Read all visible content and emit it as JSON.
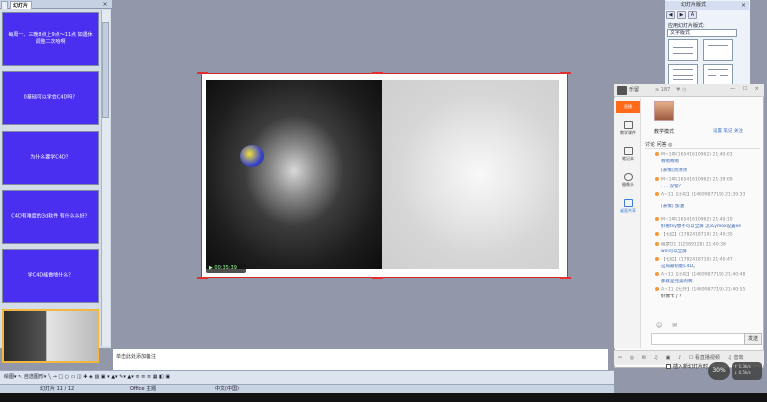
{
  "left_panel": {
    "tab_outline": "",
    "tab_slides": "幻灯片",
    "close": "×",
    "slides": [
      {
        "text": "每周一、三晚8点上9点～11点 如遇休调整二次哈啊"
      },
      {
        "text": "0基础可以学会C4D吗？"
      },
      {
        "text": "为什么要学C4D？"
      },
      {
        "text": "C4D有难度的3d软件 有什么么好？"
      },
      {
        "text": "学C4D能做啥什么？"
      },
      {
        "text": "",
        "selected": true
      }
    ]
  },
  "task_pane": {
    "title": "幻灯片版式",
    "close": "×",
    "tools": [
      "◀",
      "▶",
      "A"
    ],
    "subtitle": "应用幻灯片版式:",
    "selected_category": "文字版式"
  },
  "slide": {
    "player_time": "▶ 00:35:39"
  },
  "notes": {
    "placeholder": "单击此处添加备注"
  },
  "live": {
    "host_name": "乐留",
    "viewer_count": "≥ 187",
    "heart": "♥ ◷",
    "window_buttons": "— ☐ ×",
    "side_buttons": [
      {
        "label": "直播",
        "active": true
      },
      {
        "label": "教学课件"
      },
      {
        "label": "笔记本"
      },
      {
        "label": "摄像头"
      },
      {
        "label": "桌面共享"
      }
    ],
    "teacher_name": "教学模式",
    "teacher_links": "设置  笔记  关注",
    "tabs": "讨论    问答    ◎",
    "messages": [
      {
        "name": "M~1年(16541610962) 21:40:03",
        "text": "啦啦啦啦"
      },
      {
        "name": "",
        "text": "[表情]顶顶顶"
      },
      {
        "name": "M~1年(16541610962) 21:39:09",
        "text": ". . . 没错？"
      },
      {
        "name": "A~11【小坨】(1469987719) 21:39:33",
        "text": ""
      },
      {
        "name": "",
        "text": "[表情] 加油"
      },
      {
        "name": "M~1年(16541610962) 21:40:10",
        "text": "好看tsy想不可以全屏 怎么ymox设置ee"
      },
      {
        "name": "【七红】(1782418710) 21:40:35",
        "text": ""
      },
      {
        "name": "晓梦D1 1(2589128) 21:40:38",
        "text": "win可以全屏"
      },
      {
        "name": "【七红】(1782418710) 21:40:47",
        "text": "这局最初能C4D。"
      },
      {
        "name": "A~11【小坨】(1469987719) 21:40:48",
        "text": "那就是完美的啊"
      },
      {
        "name": "A~11【七仟】(1469987719) 21:40:55",
        "text": "好像卡了？"
      }
    ],
    "chat_icons": "☺ ✉",
    "send": "发送",
    "bottom_items": [
      "⇦",
      "◎",
      "✉",
      "♫",
      "▣",
      "♪",
      "☐ 看直播视频",
      "♫ 音效"
    ],
    "checkbox_label": "插入新幻灯片时"
  },
  "playback": {
    "percent": "30%",
    "stat1": "↑ 1.3k/s",
    "stat2": "↓ 0.5k/s"
  },
  "toolbar": {
    "text": "绘图▾  ↖  自选图形▾  ╲  →  □  ○  ▭  ◫  ✚  ◈  ▨  ▣  ▾  ▲▾  ✎▾  ▲▾  ≡  ≡  ≡  ▦  ◧  ▣"
  },
  "statusbar": {
    "slide_info": "幻灯片 11 / 12",
    "theme": "Office 主题",
    "lang": "中文(中国)"
  }
}
